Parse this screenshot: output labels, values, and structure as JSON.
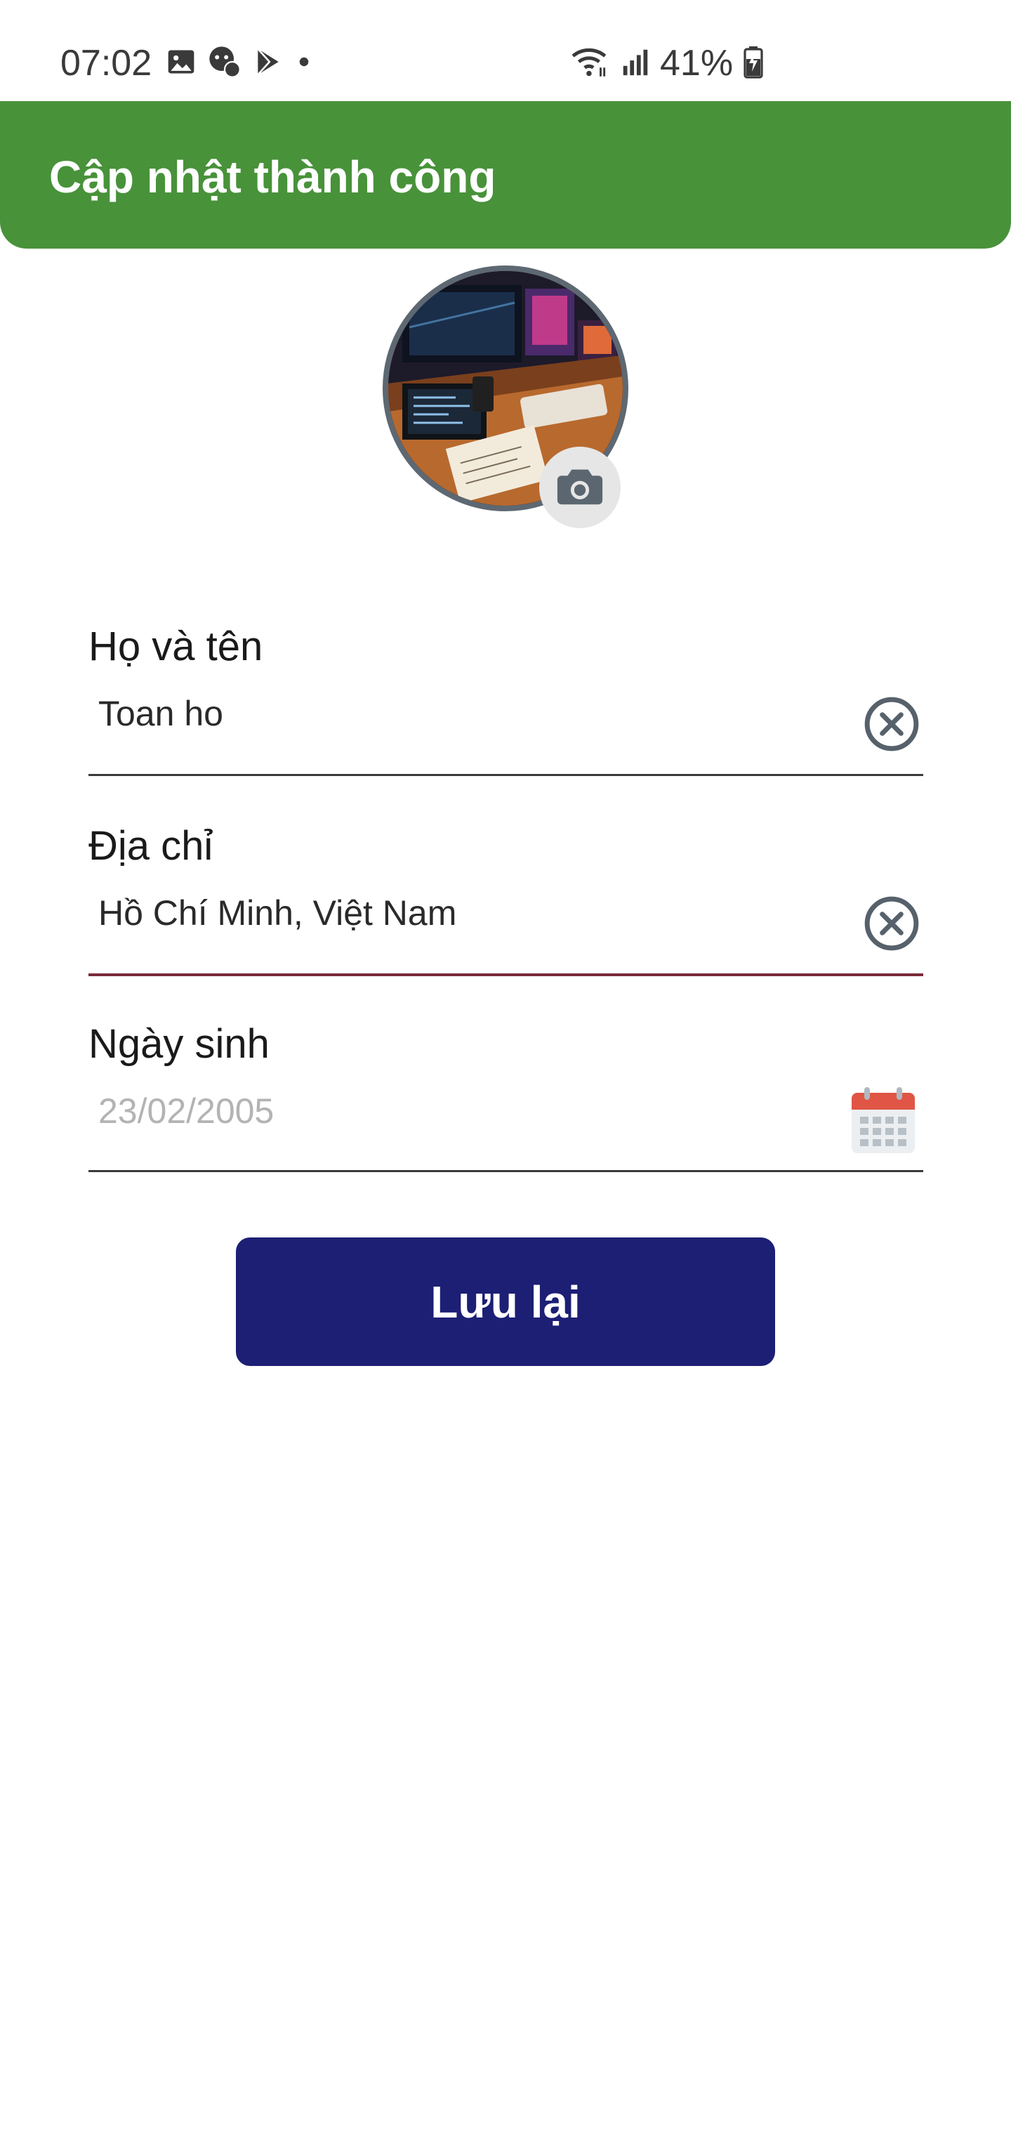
{
  "status_bar": {
    "time": "07:02",
    "battery": "41%",
    "icons": [
      "gallery-icon",
      "chat-bubbles-icon",
      "play-store-icon",
      "dot-icon",
      "wifi-icon",
      "signal-icon",
      "battery-charging-icon"
    ]
  },
  "toast": {
    "message": "Cập nhật thành công",
    "color": "#48923a"
  },
  "profile": {
    "avatar": "avatar-photo",
    "camera_icon": "camera-icon"
  },
  "form": {
    "full_name": {
      "label": "Họ và tên",
      "value": "Toan ho"
    },
    "address": {
      "label": "Địa chỉ",
      "value": "Hồ Chí Minh, Việt Nam"
    },
    "birthday": {
      "label": "Ngày sinh",
      "placeholder": "23/02/2005"
    }
  },
  "actions": {
    "save_label": "Lưu lại",
    "save_color": "#1c1f74"
  }
}
